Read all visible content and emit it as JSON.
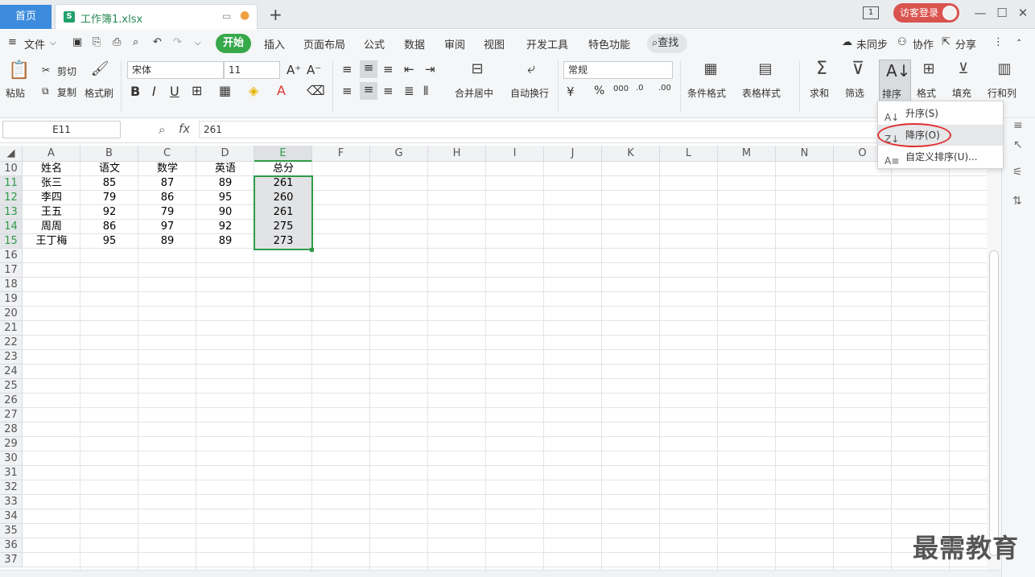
{
  "tabs": {
    "home": "首页",
    "doc": "工作簿1.xlsx"
  },
  "titlebar": {
    "login": "访客登录",
    "page_badge": "1"
  },
  "menu": {
    "file": "文件",
    "active": "开始",
    "items": [
      "插入",
      "页面布局",
      "公式",
      "数据",
      "审阅",
      "视图",
      "开发工具",
      "特色功能"
    ],
    "search": "查找",
    "sync": "未同步",
    "collab": "协作",
    "share": "分享"
  },
  "ribbon": {
    "paste": "粘贴",
    "cut": "剪切",
    "copy": "复制",
    "format_painter": "格式刷",
    "font_name": "宋体",
    "font_size": "11",
    "merge": "合并居中",
    "wrap": "自动换行",
    "number_format": "常规",
    "cond_format": "条件格式",
    "table_style": "表格样式",
    "sum": "求和",
    "filter": "筛选",
    "sort": "排序",
    "format": "格式",
    "fill": "填充",
    "rowcol": "行和列"
  },
  "formula": {
    "cell_ref": "E11",
    "fx": "fx",
    "value": "261"
  },
  "columns": [
    "A",
    "B",
    "C",
    "D",
    "E",
    "F",
    "G",
    "H",
    "I",
    "J",
    "K",
    "L",
    "M",
    "N",
    "O"
  ],
  "rows": [
    "10",
    "11",
    "12",
    "13",
    "14",
    "15",
    "16",
    "17",
    "18",
    "19",
    "20",
    "21",
    "22",
    "23",
    "24",
    "25",
    "26",
    "27",
    "28",
    "29",
    "30",
    "31",
    "32",
    "33",
    "34",
    "35",
    "36",
    "37"
  ],
  "table": [
    [
      "姓名",
      "语文",
      "数学",
      "英语",
      "总分"
    ],
    [
      "张三",
      "85",
      "87",
      "89",
      "261"
    ],
    [
      "李四",
      "79",
      "86",
      "95",
      "260"
    ],
    [
      "王五",
      "92",
      "79",
      "90",
      "261"
    ],
    [
      "周周",
      "86",
      "97",
      "92",
      "275"
    ],
    [
      "王丁梅",
      "95",
      "89",
      "89",
      "273"
    ]
  ],
  "sort_menu": {
    "asc": "升序(S)",
    "desc": "降序(O)",
    "custom": "自定义排序(U)..."
  },
  "watermark": "最需教育",
  "colors": {
    "accent": "#37a94b",
    "home_tab": "#3c8bdc",
    "selection": "#2e9a47",
    "highlight": "#e03030"
  }
}
